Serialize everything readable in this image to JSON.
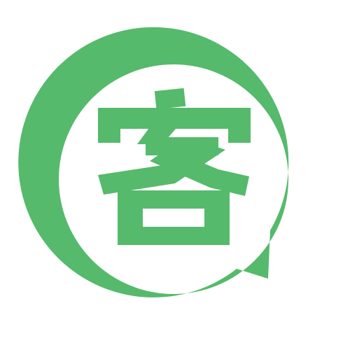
{
  "logo": {
    "character": "客",
    "icon": "chat-bubble-icon",
    "colors": {
      "brand_green": "#55BA6B",
      "background": "#FFFFFF"
    }
  }
}
